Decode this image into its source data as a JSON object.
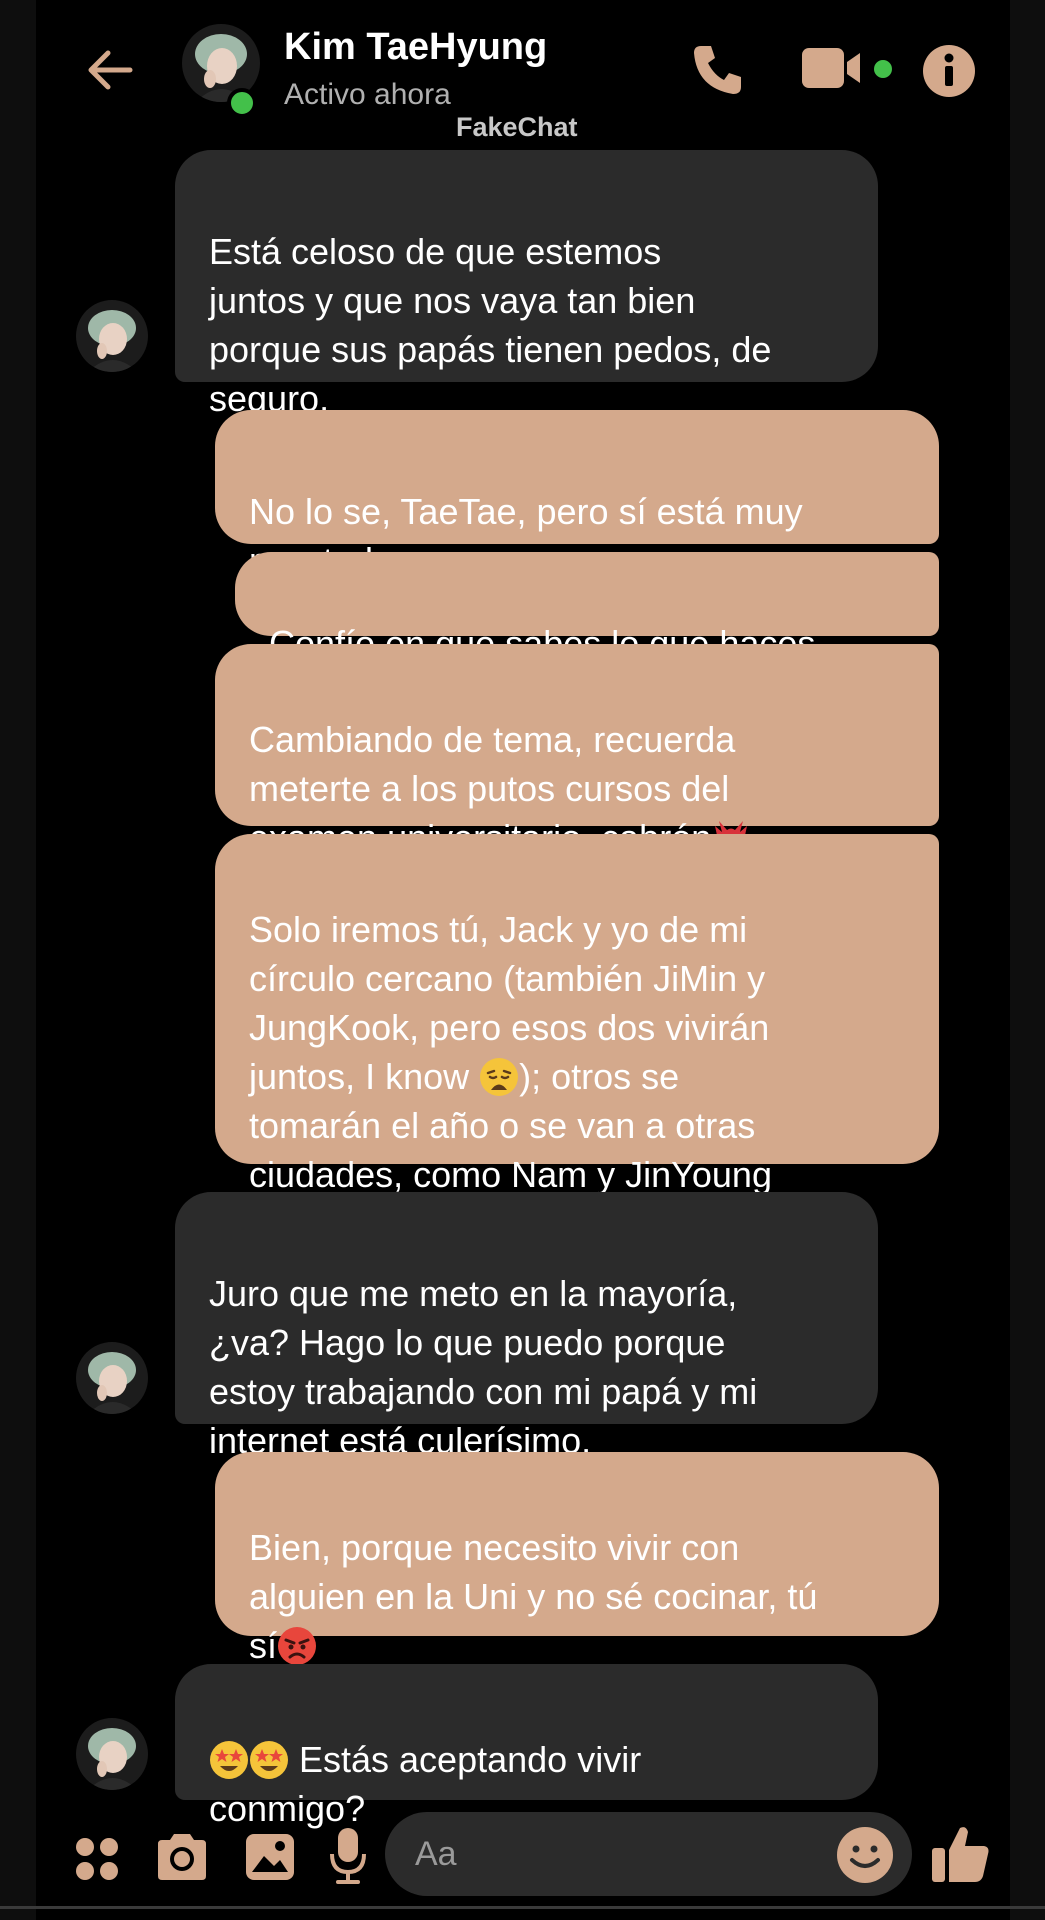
{
  "header": {
    "back_icon": "arrow-left-icon",
    "contact_name": "Kim TaeHyung",
    "status": "Activo ahora",
    "watermark": "FakeChat",
    "call_icon": "phone-icon",
    "video_icon": "video-camera-icon",
    "info_icon": "info-icon"
  },
  "colors": {
    "accent": "#d4a98c",
    "sent_bubble": "#d4a98c",
    "received_bubble": "#2b2b2b",
    "online": "#43c04a",
    "background": "#000000"
  },
  "messages": [
    {
      "from": "contact",
      "text": "Está celoso de que estemos\njuntos y que nos vaya tan bien\nporque sus papás tienen pedos, de\nseguro."
    },
    {
      "from": "me",
      "text": "No lo se, TaeTae, pero sí está muy\nraro todo."
    },
    {
      "from": "me",
      "text": "Confío en que sabes lo que haces."
    },
    {
      "from": "me",
      "text": "Cambiando de tema, recuerda\nmeterte a los putos cursos del\nexamen universitario, cabrón",
      "emoji": "goblin-mask-emoji"
    },
    {
      "from": "me",
      "text_a": "Solo iremos tú, Jack y yo de mi\ncírculo cercano (también JiMin y\nJungKook, pero esos dos vivirán\njuntos, I know ",
      "emoji": "weary-face-emoji",
      "text_b": "); otros se\ntomarán el año o se van a otras\nciudades, como Nam y JinYoung"
    },
    {
      "from": "contact",
      "text": "Juro que me meto en la mayoría,\n¿va? Hago lo que puedo porque\nestoy trabajando con mi papá y mi\ninternet está culerísimo."
    },
    {
      "from": "me",
      "text": "Bien, porque necesito vivir con\nalguien en la Uni y no sé cocinar, tú\nsí",
      "emoji": "angry-face-emoji"
    },
    {
      "from": "contact",
      "emoji": "star-struck-emoji",
      "text_a": " Estás aceptando vivir\nconmigo?"
    }
  ],
  "composer": {
    "placeholder": "Aa",
    "icons": [
      "grid-menu-icon",
      "camera-icon",
      "image-icon",
      "microphone-icon",
      "smiley-icon",
      "thumbs-up-icon"
    ]
  }
}
